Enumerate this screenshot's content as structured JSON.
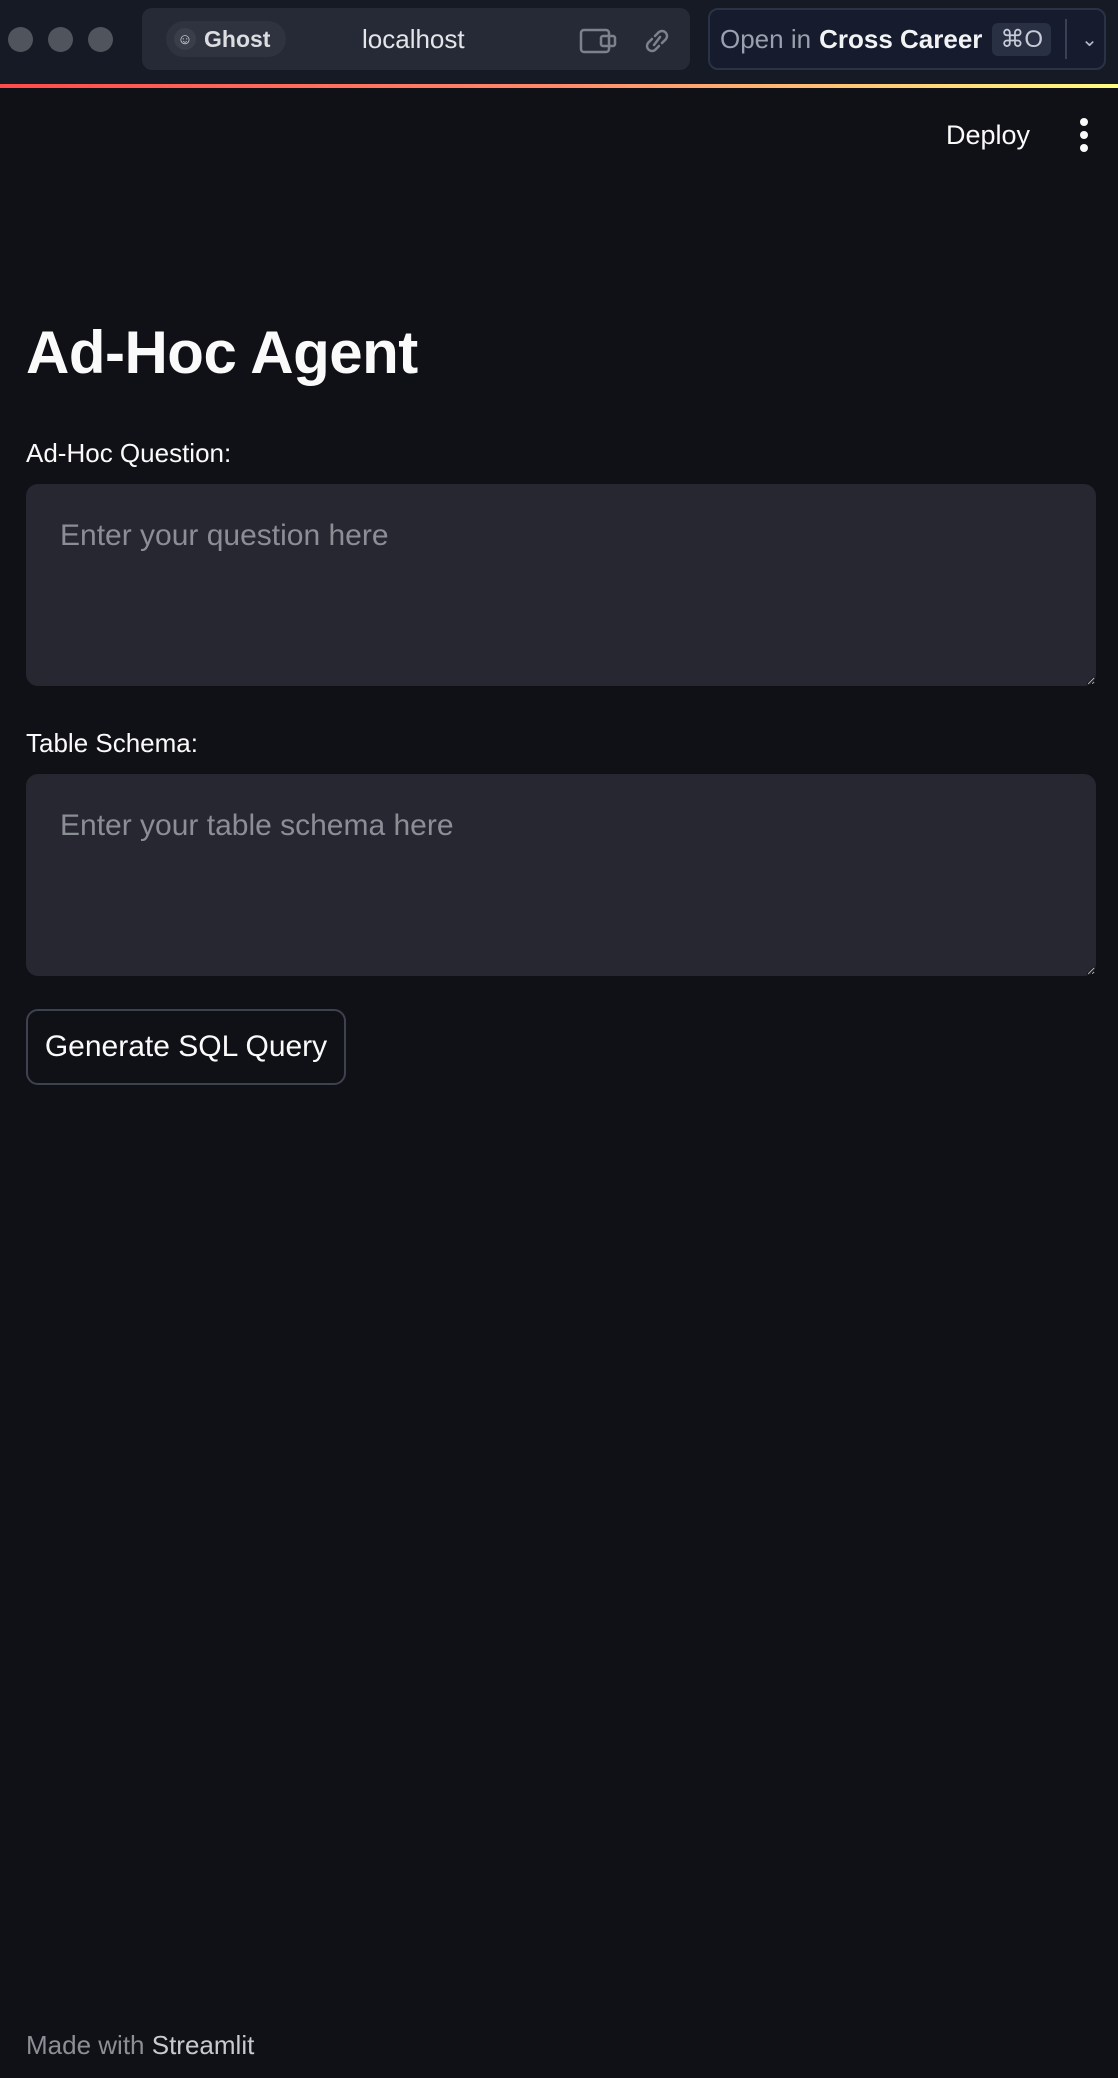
{
  "browser": {
    "profile_label": "Ghost",
    "url": "localhost",
    "open_in_prefix": "Open in",
    "open_in_app": "Cross Career",
    "open_in_shortcut": "⌘O"
  },
  "header": {
    "deploy_label": "Deploy"
  },
  "main": {
    "title": "Ad-Hoc Agent",
    "question": {
      "label": "Ad-Hoc Question:",
      "placeholder": "Enter your question here",
      "value": ""
    },
    "schema": {
      "label": "Table Schema:",
      "placeholder": "Enter your table schema here",
      "value": ""
    },
    "generate_label": "Generate SQL Query"
  },
  "footer": {
    "prefix": "Made with",
    "brand": "Streamlit"
  },
  "colors": {
    "background": "#0f1116",
    "input_bg": "#262730",
    "accent": "#ff4b4b"
  }
}
